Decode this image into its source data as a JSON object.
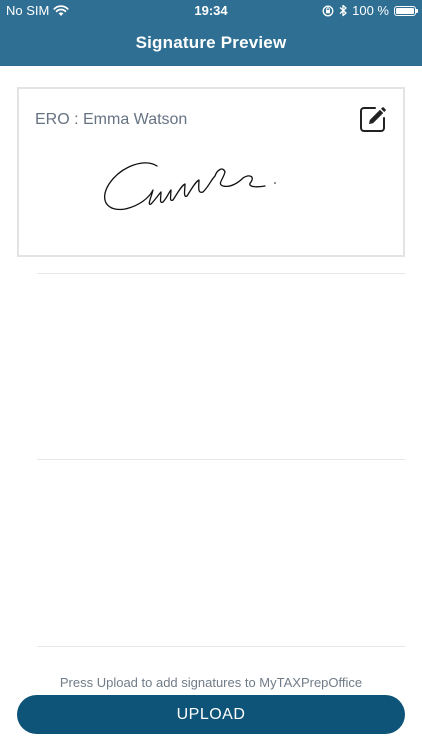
{
  "status_bar": {
    "carrier": "No SIM",
    "time": "19:34",
    "battery_text": "100 %",
    "battery_level": 1.0,
    "icons": [
      "wifi-icon",
      "orientation-lock-icon",
      "bluetooth-icon",
      "battery-icon"
    ]
  },
  "header": {
    "title": "Signature Preview",
    "background_color": "#2f6f93"
  },
  "signature_card": {
    "label": "ERO : Emma Watson",
    "edit_icon": "edit-icon"
  },
  "footer": {
    "note": "Press Upload to add signatures to MyTAXPrepOffice",
    "upload_label": "UPLOAD",
    "upload_color": "#0e5478"
  }
}
